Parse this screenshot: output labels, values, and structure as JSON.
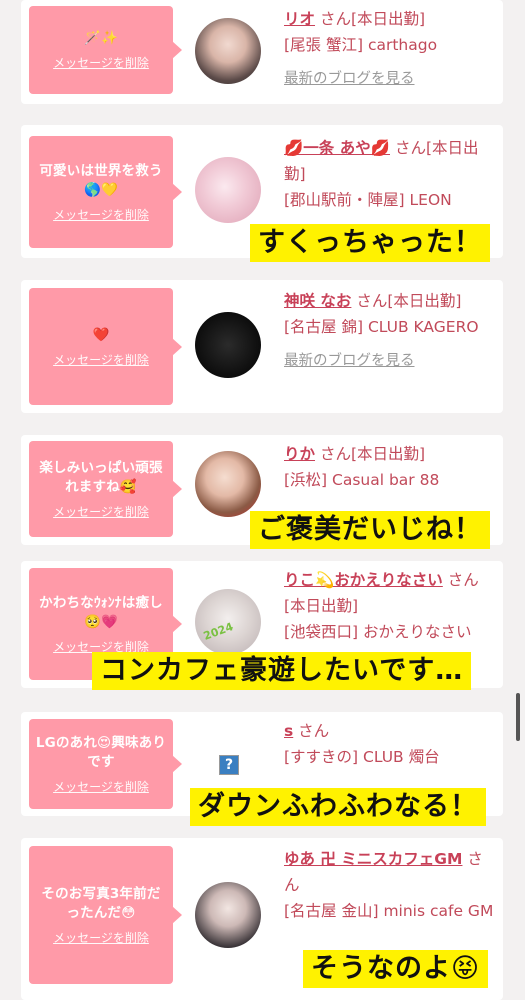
{
  "delete_label": "メッセージを削除",
  "blog_label": "最新のブログを見る",
  "cards": [
    {
      "message": "🪄✨",
      "name": "リオ",
      "san": "さん[本日出勤]",
      "shop": "[尾張 蟹江] carthago",
      "blog": true
    },
    {
      "message": "可愛いは世界を救う🌎💛",
      "name": "💋一条 あや💋",
      "san": "さん[本日出勤]",
      "shop": "[郡山駅前・陣屋] LEON",
      "blog": true
    },
    {
      "message": "❤️",
      "name": "神咲 なお",
      "san": "さん[本日出勤]",
      "shop": "[名古屋 錦] CLUB KAGERO",
      "blog": true
    },
    {
      "message": "楽しみいっぱい頑張れますね🥰",
      "name": "りか",
      "san": "さん[本日出勤]",
      "shop": "[浜松] Casual bar 88",
      "blog": true
    },
    {
      "message": "かわちなｳｫﾝﾅは癒し🥺💗",
      "name": "りこ💫おかえりなさい",
      "san": "さん[本日出勤]",
      "shop": "[池袋西口] おかえりなさい",
      "blog": true
    },
    {
      "message": "LGのあれ😍興味ありです",
      "name": "s",
      "san": "さん",
      "shop": "[すすきの] CLUB 燭台",
      "blog": true
    },
    {
      "message": "そのお写真3年前だったんだ😳",
      "name": "ゆあ 卍 ミニスカフェGM",
      "san": "さん",
      "shop": "[名古屋 金山] minis cafe GM",
      "blog": true
    }
  ],
  "overlays": [
    "すくっちゃった！",
    "ご褒美だいじね！",
    "コンカフェ豪遊したいです…",
    "ダウンふわふわなる！",
    "そうなのよ😝"
  ],
  "avatar_badge": "2024",
  "broken_image": "?",
  "colors": {
    "bubble": "#ff9aa8",
    "name": "#c84158",
    "overlay": "#fff200"
  }
}
